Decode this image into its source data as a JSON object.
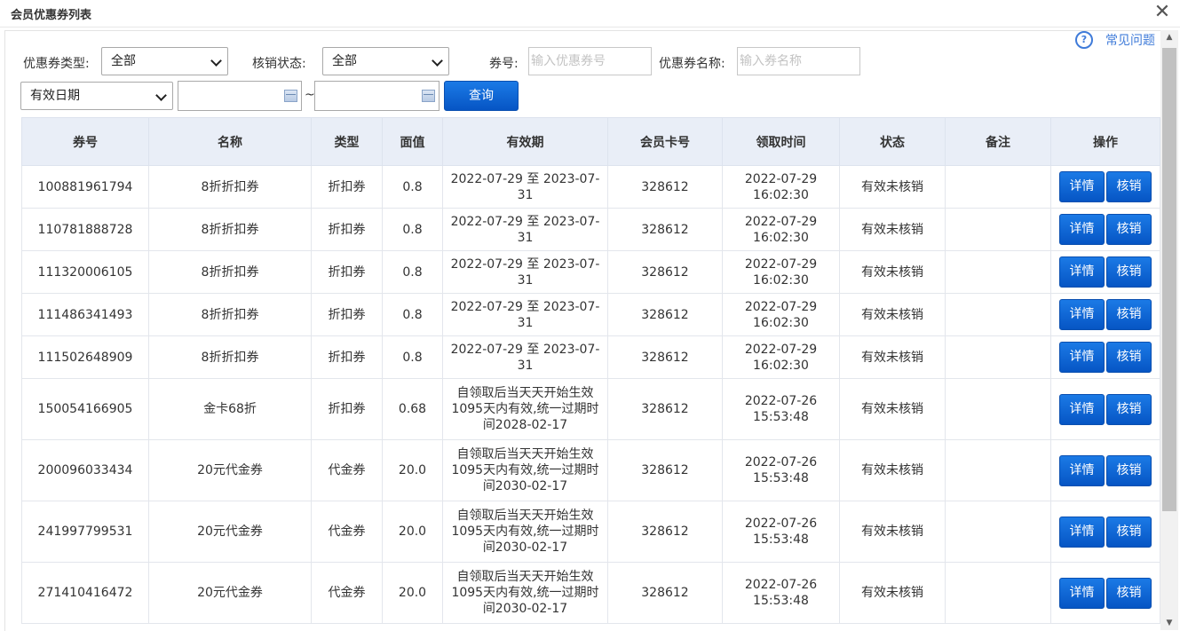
{
  "dialog": {
    "title": "会员优惠券列表",
    "close_symbol": "✕"
  },
  "faq": {
    "icon": "question-circle-icon",
    "label": "常见问题"
  },
  "filters": {
    "coupon_type_label": "优惠券类型:",
    "coupon_type_value": "全部",
    "verify_status_label": "核销状态:",
    "verify_status_value": "全部",
    "coupon_no_label": "券号:",
    "coupon_no_placeholder": "输入优惠券号",
    "coupon_name_label": "优惠券名称:",
    "coupon_name_placeholder": "输入券名称",
    "date_type_value": "有效日期",
    "date_separator": "~",
    "search_button": "查询"
  },
  "table": {
    "headers": [
      "券号",
      "名称",
      "类型",
      "面值",
      "有效期",
      "会员卡号",
      "领取时间",
      "状态",
      "备注",
      "操作"
    ],
    "detail_button": "详情",
    "verify_button": "核销",
    "rows": [
      {
        "no": "100881961794",
        "name": "8折折扣券",
        "type": "折扣券",
        "value": "0.8",
        "period": "2022-07-29 至 2023-07-31",
        "card": "328612",
        "date": "2022-07-29",
        "time": "16:02:30",
        "status": "有效未核销",
        "note": ""
      },
      {
        "no": "110781888728",
        "name": "8折折扣券",
        "type": "折扣券",
        "value": "0.8",
        "period": "2022-07-29 至 2023-07-31",
        "card": "328612",
        "date": "2022-07-29",
        "time": "16:02:30",
        "status": "有效未核销",
        "note": ""
      },
      {
        "no": "111320006105",
        "name": "8折折扣券",
        "type": "折扣券",
        "value": "0.8",
        "period": "2022-07-29 至 2023-07-31",
        "card": "328612",
        "date": "2022-07-29",
        "time": "16:02:30",
        "status": "有效未核销",
        "note": ""
      },
      {
        "no": "111486341493",
        "name": "8折折扣券",
        "type": "折扣券",
        "value": "0.8",
        "period": "2022-07-29 至 2023-07-31",
        "card": "328612",
        "date": "2022-07-29",
        "time": "16:02:30",
        "status": "有效未核销",
        "note": ""
      },
      {
        "no": "111502648909",
        "name": "8折折扣券",
        "type": "折扣券",
        "value": "0.8",
        "period": "2022-07-29 至 2023-07-31",
        "card": "328612",
        "date": "2022-07-29",
        "time": "16:02:30",
        "status": "有效未核销",
        "note": ""
      },
      {
        "no": "150054166905",
        "name": "金卡68折",
        "type": "折扣券",
        "value": "0.68",
        "period": "自领取后当天天开始生效1095天内有效,统一过期时间2028-02-17",
        "card": "328612",
        "date": "2022-07-26",
        "time": "15:53:48",
        "status": "有效未核销",
        "note": ""
      },
      {
        "no": "200096033434",
        "name": "20元代金券",
        "type": "代金券",
        "value": "20.0",
        "period": "自领取后当天天开始生效1095天内有效,统一过期时间2030-02-17",
        "card": "328612",
        "date": "2022-07-26",
        "time": "15:53:48",
        "status": "有效未核销",
        "note": ""
      },
      {
        "no": "241997799531",
        "name": "20元代金券",
        "type": "代金券",
        "value": "20.0",
        "period": "自领取后当天天开始生效1095天内有效,统一过期时间2030-02-17",
        "card": "328612",
        "date": "2022-07-26",
        "time": "15:53:48",
        "status": "有效未核销",
        "note": ""
      },
      {
        "no": "271410416472",
        "name": "20元代金券",
        "type": "代金券",
        "value": "20.0",
        "period": "自领取后当天天开始生效1095天内有效,统一过期时间2030-02-17",
        "card": "328612",
        "date": "2022-07-26",
        "time": "15:53:48",
        "status": "有效未核销",
        "note": ""
      }
    ]
  },
  "scrollbar": {
    "up_symbol": "▲",
    "down_symbol": "▼"
  }
}
